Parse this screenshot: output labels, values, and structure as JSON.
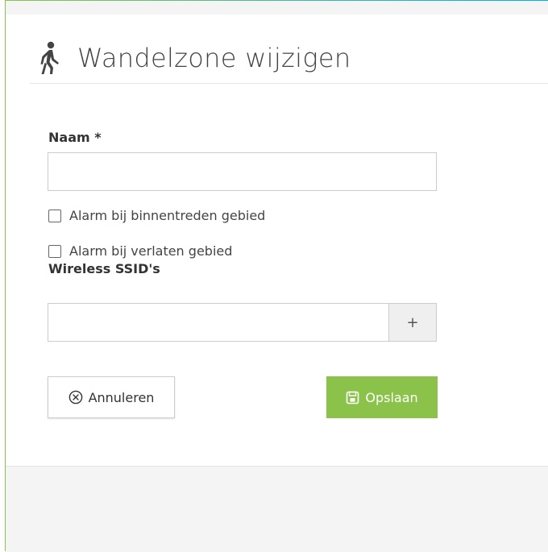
{
  "dialog": {
    "title": "Wandelzone wijzigen",
    "title_icon": "walking-person-icon"
  },
  "form": {
    "name_label": "Naam *",
    "name_value": "",
    "alarm_enter_label": "Alarm bij binnentreden gebied",
    "alarm_enter_checked": false,
    "alarm_leave_label": "Alarm bij verlaten gebied",
    "alarm_leave_checked": false,
    "ssid_label": "Wireless SSID's",
    "ssid_value": "",
    "ssid_add_label": "+"
  },
  "actions": {
    "cancel_label": "Annuleren",
    "cancel_icon": "circle-x-icon",
    "save_label": "Opslaan",
    "save_icon": "floppy-disk-icon"
  },
  "colors": {
    "accent_green": "#8bc34a",
    "accent_blue": "#00aeef"
  }
}
